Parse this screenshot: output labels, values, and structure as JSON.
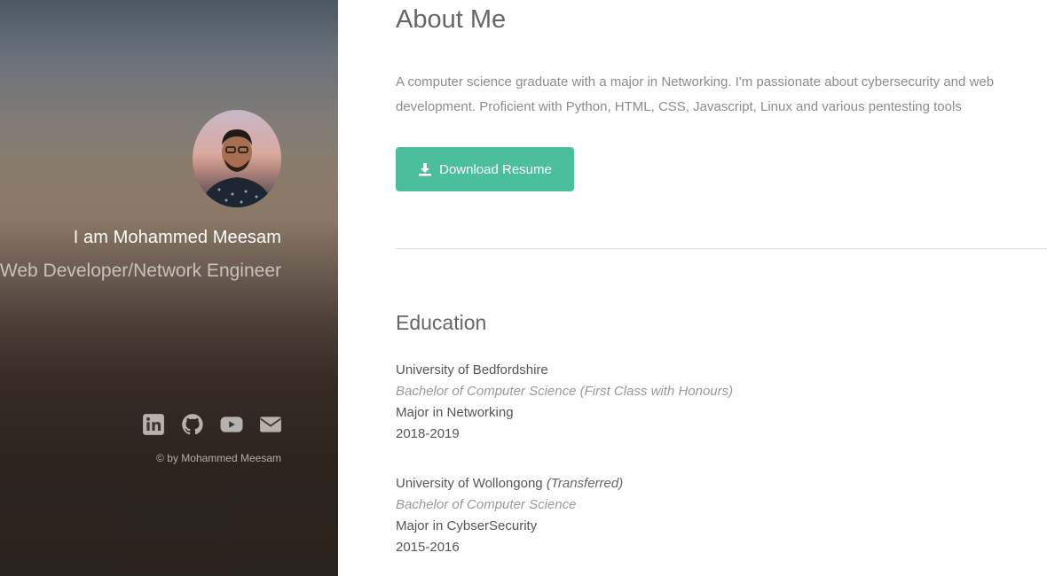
{
  "sidebar": {
    "intro": "I am Mohammed Meesam",
    "role": "Web Developer/Network Engineer",
    "copyright": "© by Mohammed Meesam",
    "social": [
      {
        "icon": "linkedin-icon"
      },
      {
        "icon": "github-icon"
      },
      {
        "icon": "youtube-icon"
      },
      {
        "icon": "envelope-icon"
      }
    ],
    "social_color": "#b7b2ad"
  },
  "about": {
    "title": "About Me",
    "text": "A computer science graduate with a major in Networking. I'm passionate about cybersecurity and web development. Proficient with Python, HTML, CSS, Javascript, Linux and various pentesting tools",
    "download_label": "Download Resume",
    "download_icon": "download-icon",
    "button_color": "#4bbe9b"
  },
  "education": {
    "title": "Education",
    "entries": [
      {
        "school": "University of Bedfordshire",
        "note": "",
        "degree": "Bachelor of Computer Science (First Class with Honours)",
        "major": "Major in Networking",
        "years": "2018-2019"
      },
      {
        "school": "University of Wollongong",
        "note": "(Transferred)",
        "degree": "Bachelor of Computer Science",
        "major": "Major in CybserSecurity",
        "years": "2015-2016"
      }
    ]
  }
}
